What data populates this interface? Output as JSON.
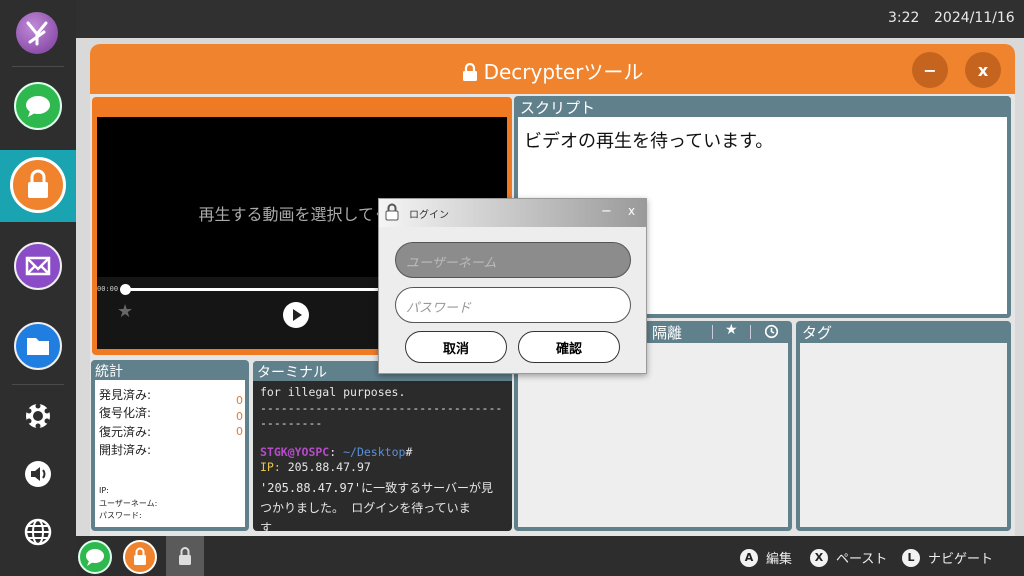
{
  "clock": {
    "time": "3:22",
    "date": "2024/11/16"
  },
  "window": {
    "title": "Decrypterツール",
    "minimize_label": "−",
    "close_label": "x"
  },
  "video": {
    "placeholder": "再生する動画を選択してくだ",
    "time_current": "00:00"
  },
  "script_panel": {
    "title": "スクリプト",
    "content": "ビデオの再生を待っています。"
  },
  "quarantine_panel": {
    "title": "隔離"
  },
  "tags_panel": {
    "title": "タグ"
  },
  "stats": {
    "title": "統計",
    "rows": [
      {
        "label": "発見済み:",
        "value": "0"
      },
      {
        "label": "復号化済:",
        "value": "0"
      },
      {
        "label": "復元済み:",
        "value": "0"
      },
      {
        "label": "開封済み:",
        "value": ""
      }
    ],
    "ip_label": "IP:",
    "username_label": "ユーザーネーム:",
    "password_label": "パスワード:"
  },
  "terminal": {
    "title": "ターミナル",
    "line1": "for illegal purposes.",
    "line2": "-----------------------------------",
    "line3": "---------",
    "prompt_user": "STGK@YOSPC",
    "prompt_sep": ":",
    "prompt_path": " ~/Desktop",
    "prompt_end": "#",
    "ip_key": "IP:",
    "ip_value": " 205.88.47.97",
    "msg1": "'205.88.47.97'に一致するサーバーが見",
    "msg2": "つかりました。 ログインを待っていま",
    "msg3": "す"
  },
  "login": {
    "title": "ログイン",
    "minimize_label": "−",
    "close_label": "x",
    "username_placeholder": "ユーザーネーム",
    "password_placeholder": "パスワード",
    "cancel_label": "取消",
    "confirm_label": "確認"
  },
  "hints": [
    {
      "key": "A",
      "label": "編集"
    },
    {
      "key": "X",
      "label": "ペースト"
    },
    {
      "key": "L",
      "label": "ナビゲート"
    }
  ],
  "colors": {
    "accent": "#f0842e",
    "panel_header": "#60808c",
    "active_dock": "#1aa3b1",
    "terminal_user": "#b44cc9",
    "terminal_path": "#5b8fd9",
    "terminal_ip": "#e8c447"
  }
}
